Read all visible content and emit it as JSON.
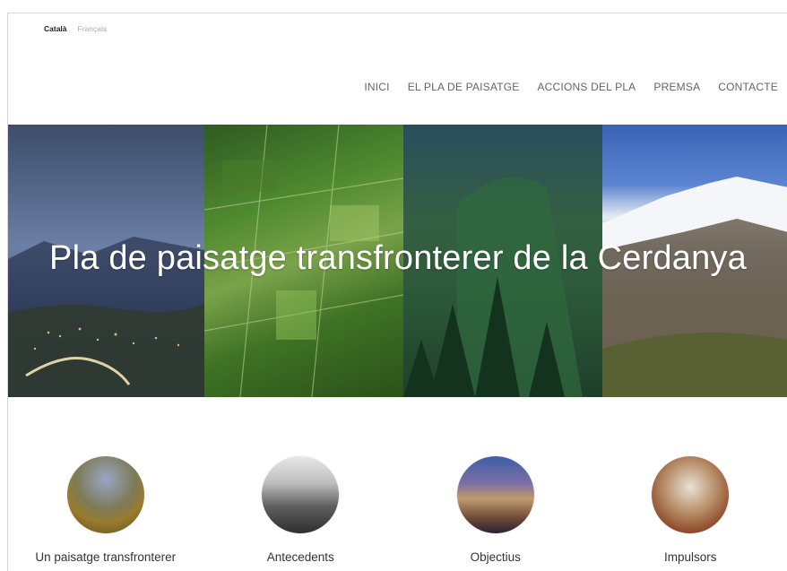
{
  "languages": {
    "active": "Català",
    "inactive": "Français"
  },
  "nav": {
    "items": [
      "INICI",
      "EL PLA DE PAISATGE",
      "ACCIONS DEL PLA",
      "PREMSA",
      "CONTACTE"
    ]
  },
  "hero": {
    "title": "Pla de paisatge transfronterer de la Cerdanya"
  },
  "cards": [
    {
      "label": "Un paisatge transfronterer"
    },
    {
      "label": "Antecedents"
    },
    {
      "label": "Objectius"
    },
    {
      "label": "Impulsors"
    }
  ]
}
